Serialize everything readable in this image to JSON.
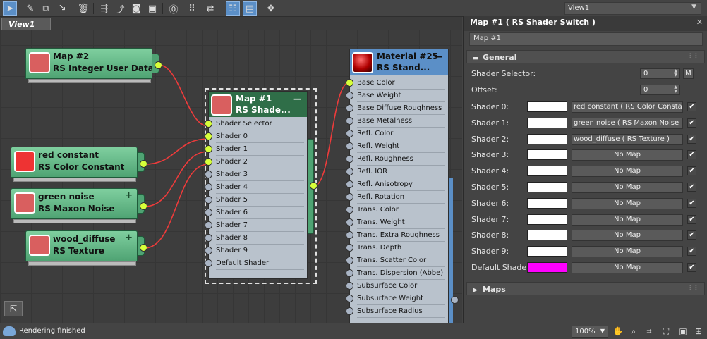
{
  "toolbar": {
    "icons": [
      "select-arrow-icon",
      "eyedropper-icon",
      "pick-material-icon",
      "assign-material-icon",
      "delete-icon",
      "move-children-icon",
      "layout-icon",
      "hide-unused-icon",
      "layout-all-icon",
      "show-shaded-icon",
      "options-icon",
      "show-bg-icon",
      "layout-toggle-icon",
      "pan-icon",
      "material-map-icon"
    ],
    "view_dropdown": "View1"
  },
  "tab": {
    "label": "View1"
  },
  "nodes": {
    "map2": {
      "title": "Map #2",
      "type": "RS Integer User Data",
      "swatch": "#d95f5f"
    },
    "red_constant": {
      "title": "red constant",
      "type": "RS Color Constant",
      "swatch": "#ee3333"
    },
    "green_noise": {
      "title": "green noise",
      "type": "RS Maxon Noise",
      "swatch": "#d95f5f"
    },
    "wood_diffuse": {
      "title": "wood_diffuse",
      "type": "RS Texture",
      "swatch": "#d95f5f"
    },
    "map1": {
      "title": "Map #1",
      "type": "RS Shade...",
      "swatch": "#d95f5f",
      "rows": [
        "Shader Selector",
        "Shader 0",
        "Shader 1",
        "Shader 2",
        "Shader 3",
        "Shader 4",
        "Shader 5",
        "Shader 6",
        "Shader 7",
        "Shader 8",
        "Shader 9",
        "Default Shader"
      ]
    },
    "material25": {
      "title": "Material #25",
      "type": "RS Stand...",
      "rows": [
        "Base Color",
        "Base Weight",
        "Base Diffuse Roughness",
        "Base Metalness",
        "Refl. Color",
        "Refl. Weight",
        "Refl. Roughness",
        "Refl. IOR",
        "Refl. Anisotropy",
        "Refl. Rotation",
        "Trans. Color",
        "Trans. Weight",
        "Trans. Extra Roughness",
        "Trans. Depth",
        "Trans. Scatter Color",
        "Trans. Dispersion (Abbe)",
        "Subsurface Color",
        "Subsurface Weight",
        "Subsurface Radius"
      ]
    }
  },
  "status": {
    "message": "Rendering finished",
    "zoom": "100%"
  },
  "panel": {
    "title": "Map #1  ( RS Shader Switch )",
    "name_field": "Map #1",
    "general_label": "General",
    "maps_label": "Maps",
    "shader_selector": {
      "label": "Shader Selector:",
      "value": "0",
      "m_button": "M"
    },
    "offset": {
      "label": "Offset:",
      "value": "0"
    },
    "shaders": [
      {
        "label": "Shader 0:",
        "color": "#ffffff",
        "map": "red constant  ( RS Color Constant )",
        "checked": "✔"
      },
      {
        "label": "Shader 1:",
        "color": "#ffffff",
        "map": "green noise  ( RS Maxon Noise )",
        "checked": "✔"
      },
      {
        "label": "Shader 2:",
        "color": "#ffffff",
        "map": "wood_diffuse  ( RS Texture )",
        "checked": "✔"
      },
      {
        "label": "Shader 3:",
        "color": "#ffffff",
        "map": "No Map",
        "checked": "✔"
      },
      {
        "label": "Shader 4:",
        "color": "#ffffff",
        "map": "No Map",
        "checked": "✔"
      },
      {
        "label": "Shader 5:",
        "color": "#ffffff",
        "map": "No Map",
        "checked": "✔"
      },
      {
        "label": "Shader 6:",
        "color": "#ffffff",
        "map": "No Map",
        "checked": "✔"
      },
      {
        "label": "Shader 7:",
        "color": "#ffffff",
        "map": "No Map",
        "checked": "✔"
      },
      {
        "label": "Shader 8:",
        "color": "#ffffff",
        "map": "No Map",
        "checked": "✔"
      },
      {
        "label": "Shader 9:",
        "color": "#ffffff",
        "map": "No Map",
        "checked": "✔"
      },
      {
        "label": "Default Shader:",
        "color": "#ff00ff",
        "map": "No Map",
        "checked": "✔"
      }
    ]
  }
}
